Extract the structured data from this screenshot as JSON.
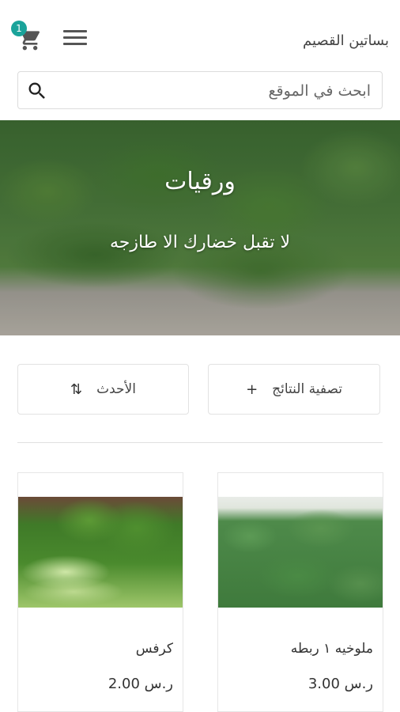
{
  "header": {
    "brand": "بساتين القصيم",
    "cart_count": "1",
    "cart_icon": "shopping-cart-icon",
    "menu_icon": "hamburger-menu-icon"
  },
  "search": {
    "placeholder": "ابحث في الموقع",
    "icon": "search-icon"
  },
  "hero": {
    "title": "ورقيات",
    "subtitle": "لا تقبل خضارك الا طازجه"
  },
  "controls": {
    "filter_label": "تصفية النتائج",
    "filter_icon": "+",
    "sort_label": "الأحدث",
    "sort_icon": "⇅"
  },
  "products": [
    {
      "name": "ملوخيه ١ ربطه",
      "price": "ر.س 3.00"
    },
    {
      "name": "كرفس",
      "price": "ر.س 2.00"
    }
  ],
  "colors": {
    "accent": "#1aa39a"
  }
}
